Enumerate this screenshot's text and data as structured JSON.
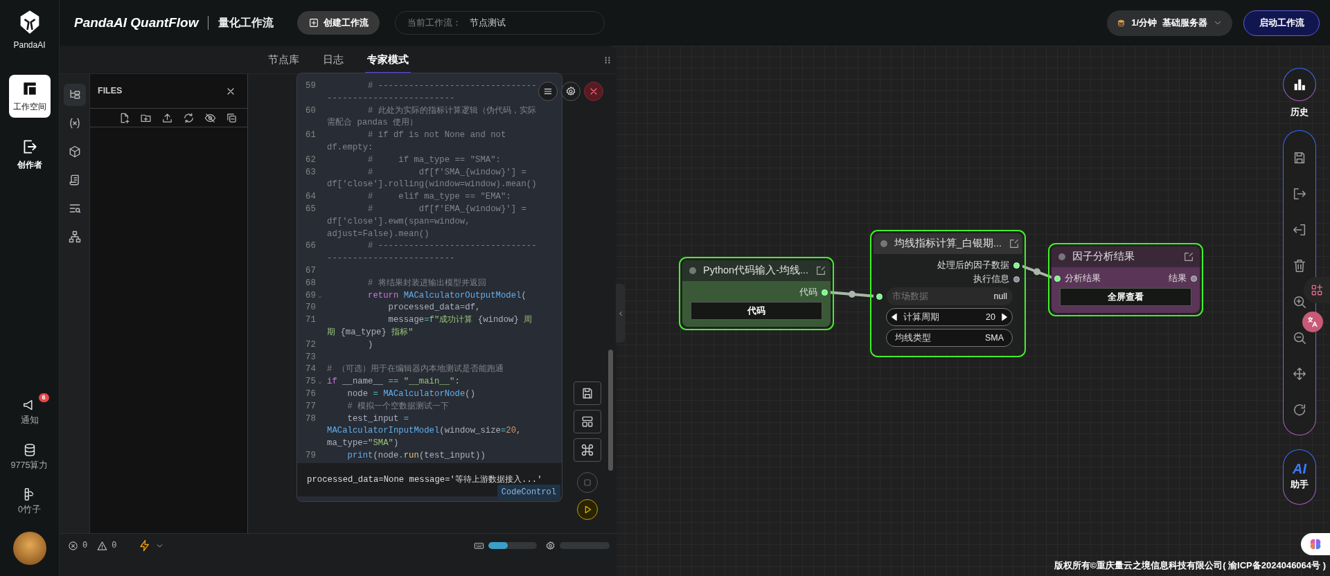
{
  "rail": {
    "logo": "PandaAI",
    "items": [
      {
        "label": "工作空间",
        "selected": true
      },
      {
        "label": "创作者",
        "selected": false
      }
    ],
    "bottom": [
      {
        "kind": "notify",
        "label": "通知",
        "badge": "6"
      },
      {
        "kind": "coins",
        "label": "9775算力"
      },
      {
        "kind": "bamboo",
        "label": "0竹子"
      }
    ]
  },
  "header": {
    "brand": "PandaAI QuantFlow",
    "subtitle": "量化工作流",
    "create_button": "创建工作流",
    "current_label": "当前工作流：",
    "current_value": "节点测试",
    "server": {
      "rate": "1/分钟",
      "name": "基础服务器"
    },
    "start_button": "启动工作流"
  },
  "panel": {
    "tabs": [
      {
        "label": "节点库",
        "selected": false
      },
      {
        "label": "日志",
        "selected": false
      },
      {
        "label": "专家模式",
        "selected": true
      }
    ],
    "files": {
      "title": "FILES"
    },
    "code_lines": [
      {
        "number": "59",
        "tokens": [
          {
            "kind": "comment",
            "text": "        # --------------------------------------------------------"
          }
        ]
      },
      {
        "number": "60",
        "tokens": [
          {
            "kind": "comment",
            "text": "        # 此处为实际的指标计算逻辑（伪代码，实际需配合 pandas 使用）"
          }
        ]
      },
      {
        "number": "61",
        "tokens": [
          {
            "kind": "comment",
            "text": "        # if df is not None and not df.empty:"
          }
        ]
      },
      {
        "number": "62",
        "tokens": [
          {
            "kind": "comment",
            "text": "        #     if ma_type == \"SMA\":"
          }
        ]
      },
      {
        "number": "63",
        "tokens": [
          {
            "kind": "comment",
            "text": "        #         df[f'SMA_{window}'] = df['close'].rolling(window=window).mean()"
          }
        ]
      },
      {
        "number": "64",
        "tokens": [
          {
            "kind": "comment",
            "text": "        #     elif ma_type == \"EMA\":"
          }
        ]
      },
      {
        "number": "65",
        "tokens": [
          {
            "kind": "comment",
            "text": "        #         df[f'EMA_{window}'] = df['close'].ewm(span=window, adjust=False).mean()"
          }
        ]
      },
      {
        "number": "66",
        "tokens": [
          {
            "kind": "comment",
            "text": "        # --------------------------------------------------------"
          }
        ]
      },
      {
        "number": "67"
      },
      {
        "number": "68",
        "tokens": [
          {
            "kind": "comment",
            "text": "        # 将结果封装进输出模型并返回"
          }
        ]
      },
      {
        "number": "69",
        "foldable": true,
        "tokens": [
          {
            "kind": "keyword",
            "text": "        return"
          },
          {
            "kind": "class",
            "text": " MACalculatorOutputModel"
          },
          {
            "kind": "plain",
            "text": "("
          }
        ]
      },
      {
        "number": "70",
        "tokens": [
          {
            "kind": "plain",
            "text": "            processed_data"
          },
          {
            "kind": "op",
            "text": "="
          },
          {
            "kind": "plain",
            "text": "df,"
          }
        ]
      },
      {
        "number": "71",
        "tokens": [
          {
            "kind": "plain",
            "text": "            message"
          },
          {
            "kind": "op",
            "text": "="
          },
          {
            "kind": "string",
            "text": "f\"成功计算 "
          },
          {
            "kind": "plain",
            "text": "{window}"
          },
          {
            "kind": "string",
            "text": " 周期 "
          },
          {
            "kind": "plain",
            "text": "{ma_type}"
          },
          {
            "kind": "string",
            "text": " 指标\""
          }
        ]
      },
      {
        "number": "72",
        "tokens": [
          {
            "kind": "plain",
            "text": "        )"
          }
        ]
      },
      {
        "number": "73"
      },
      {
        "number": "74",
        "tokens": [
          {
            "kind": "comment",
            "text": "# （可选）用于在编辑器内本地测试是否能跑通"
          }
        ]
      },
      {
        "number": "75",
        "foldable": true,
        "tokens": [
          {
            "kind": "keyword",
            "text": "if"
          },
          {
            "kind": "plain",
            "text": " __name__ "
          },
          {
            "kind": "op",
            "text": "=="
          },
          {
            "kind": "string",
            "text": " \"__main__\""
          },
          {
            "kind": "plain",
            "text": ":"
          }
        ]
      },
      {
        "number": "76",
        "tokens": [
          {
            "kind": "plain",
            "text": "    node "
          },
          {
            "kind": "op",
            "text": "="
          },
          {
            "kind": "class",
            "text": " MACalculatorNode"
          },
          {
            "kind": "plain",
            "text": "()"
          }
        ]
      },
      {
        "number": "77",
        "tokens": [
          {
            "kind": "comment",
            "text": "    # 模拟一个空数据测试一下"
          }
        ]
      },
      {
        "number": "78",
        "tokens": [
          {
            "kind": "plain",
            "text": "    test_input "
          },
          {
            "kind": "op",
            "text": "="
          },
          {
            "kind": "class",
            "text": " MACalculatorInputModel"
          },
          {
            "kind": "plain",
            "text": "(window_size"
          },
          {
            "kind": "op",
            "text": "="
          },
          {
            "kind": "number",
            "text": "20"
          },
          {
            "kind": "plain",
            "text": ", ma_type"
          },
          {
            "kind": "op",
            "text": "="
          },
          {
            "kind": "string",
            "text": "\"SMA\""
          },
          {
            "kind": "plain",
            "text": ")"
          }
        ]
      },
      {
        "number": "79",
        "tokens": [
          {
            "kind": "class",
            "text": "    print"
          },
          {
            "kind": "plain",
            "text": "(node"
          },
          {
            "kind": "op",
            "text": "."
          },
          {
            "kind": "method",
            "text": "run"
          },
          {
            "kind": "plain",
            "text": "(test_input))"
          }
        ]
      }
    ],
    "output": "processed_data=None message='等待上游数据接入...'",
    "tag": "CodeControl",
    "status": {
      "errors": "0",
      "warnings": "0",
      "meters": [
        {
          "kind": "keyboard",
          "level": 0.4
        },
        {
          "kind": "settings"
        }
      ]
    }
  },
  "nodes": [
    {
      "title": "Python代码输入-均线...",
      "kind": "green",
      "selected": true,
      "rows": [
        {
          "kind": "output",
          "label": "代码",
          "connected": true
        },
        {
          "kind": "button",
          "label": "代码"
        }
      ]
    },
    {
      "title": "均线指标计算_白银期...",
      "kind": "dark",
      "selected": true,
      "rows": [
        {
          "kind": "output",
          "label": "处理后的因子数据",
          "connected": true
        },
        {
          "kind": "output",
          "label": "执行信息",
          "connected": false
        },
        {
          "kind": "input",
          "label": "市场数据",
          "value": "null",
          "connected": true
        },
        {
          "kind": "stepper",
          "label": "计算周期",
          "value": "20"
        },
        {
          "kind": "combo",
          "label": "均线类型",
          "value": "SMA"
        }
      ]
    },
    {
      "title": "因子分析结果",
      "kind": "purple",
      "selected": true,
      "rows": [
        {
          "kind": "io",
          "input_label": "分析结果",
          "input_connected": true,
          "output_label": "结果",
          "output_connected": false
        },
        {
          "kind": "button",
          "label": "全屏查看"
        }
      ]
    }
  ],
  "toolbar": {
    "history": "历史",
    "assistant_logo": "AI",
    "assistant": "助手"
  },
  "footer": "版权所有©重庆量云之境信息科技有限公司( 渝ICP备2024046064号 )"
}
